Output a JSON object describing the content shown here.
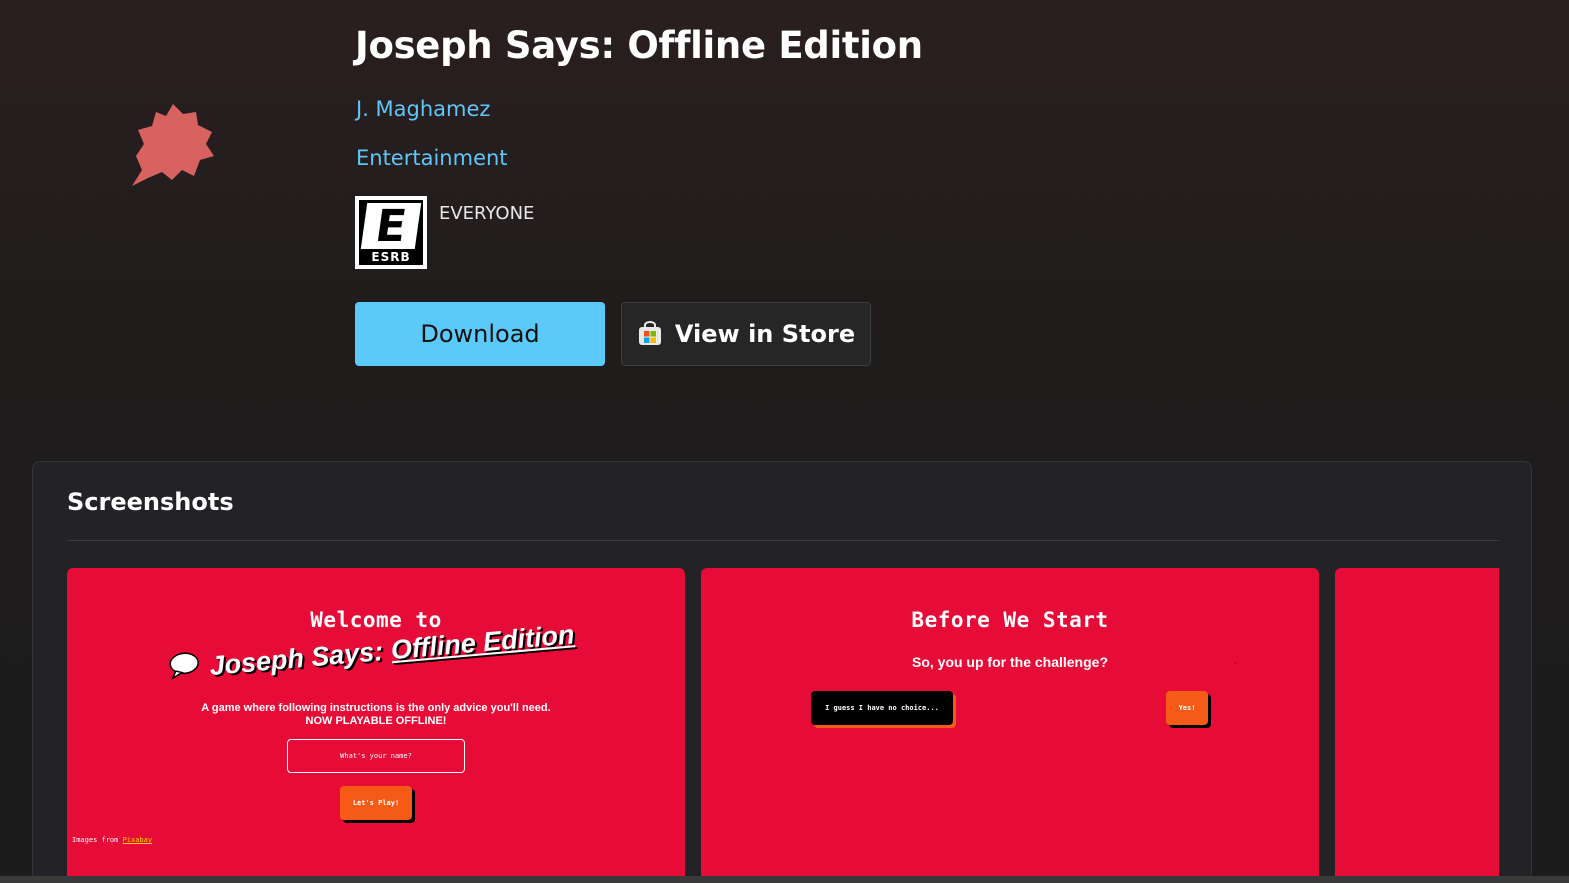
{
  "app": {
    "title": "Joseph Says: Offline Edition",
    "publisher": "J. Maghamez",
    "category": "Entertainment",
    "icon": "starburst-icon"
  },
  "rating": {
    "badge_letter": "E",
    "badge_label": "ESRB",
    "text": "EVERYONE"
  },
  "actions": {
    "download_label": "Download",
    "store_label": "View in Store",
    "store_icon": "microsoft-store-icon"
  },
  "screenshots": {
    "title": "Screenshots",
    "shot1": {
      "heading": "Welcome to",
      "logo_main": "Joseph Says:",
      "logo_offline": "Offline Edition",
      "subtitle_line1": "A game where following instructions is the only advice you'll need.",
      "subtitle_line2": "NOW PLAYABLE OFFLINE!",
      "name_placeholder": "What's your name?",
      "play_label": "Let's Play!",
      "credit_prefix": "Images from",
      "credit_link": "Pixabay"
    },
    "shot2": {
      "heading": "Before We Start",
      "question": "So, you up for the challenge?",
      "no_label": "I guess I have no choice...",
      "yes_label": "Yes!"
    }
  },
  "colors": {
    "accent": "#5ccaf9",
    "link": "#5fc6f7",
    "screenshot_bg": "#e70b37",
    "game_button": "#f55a16"
  }
}
